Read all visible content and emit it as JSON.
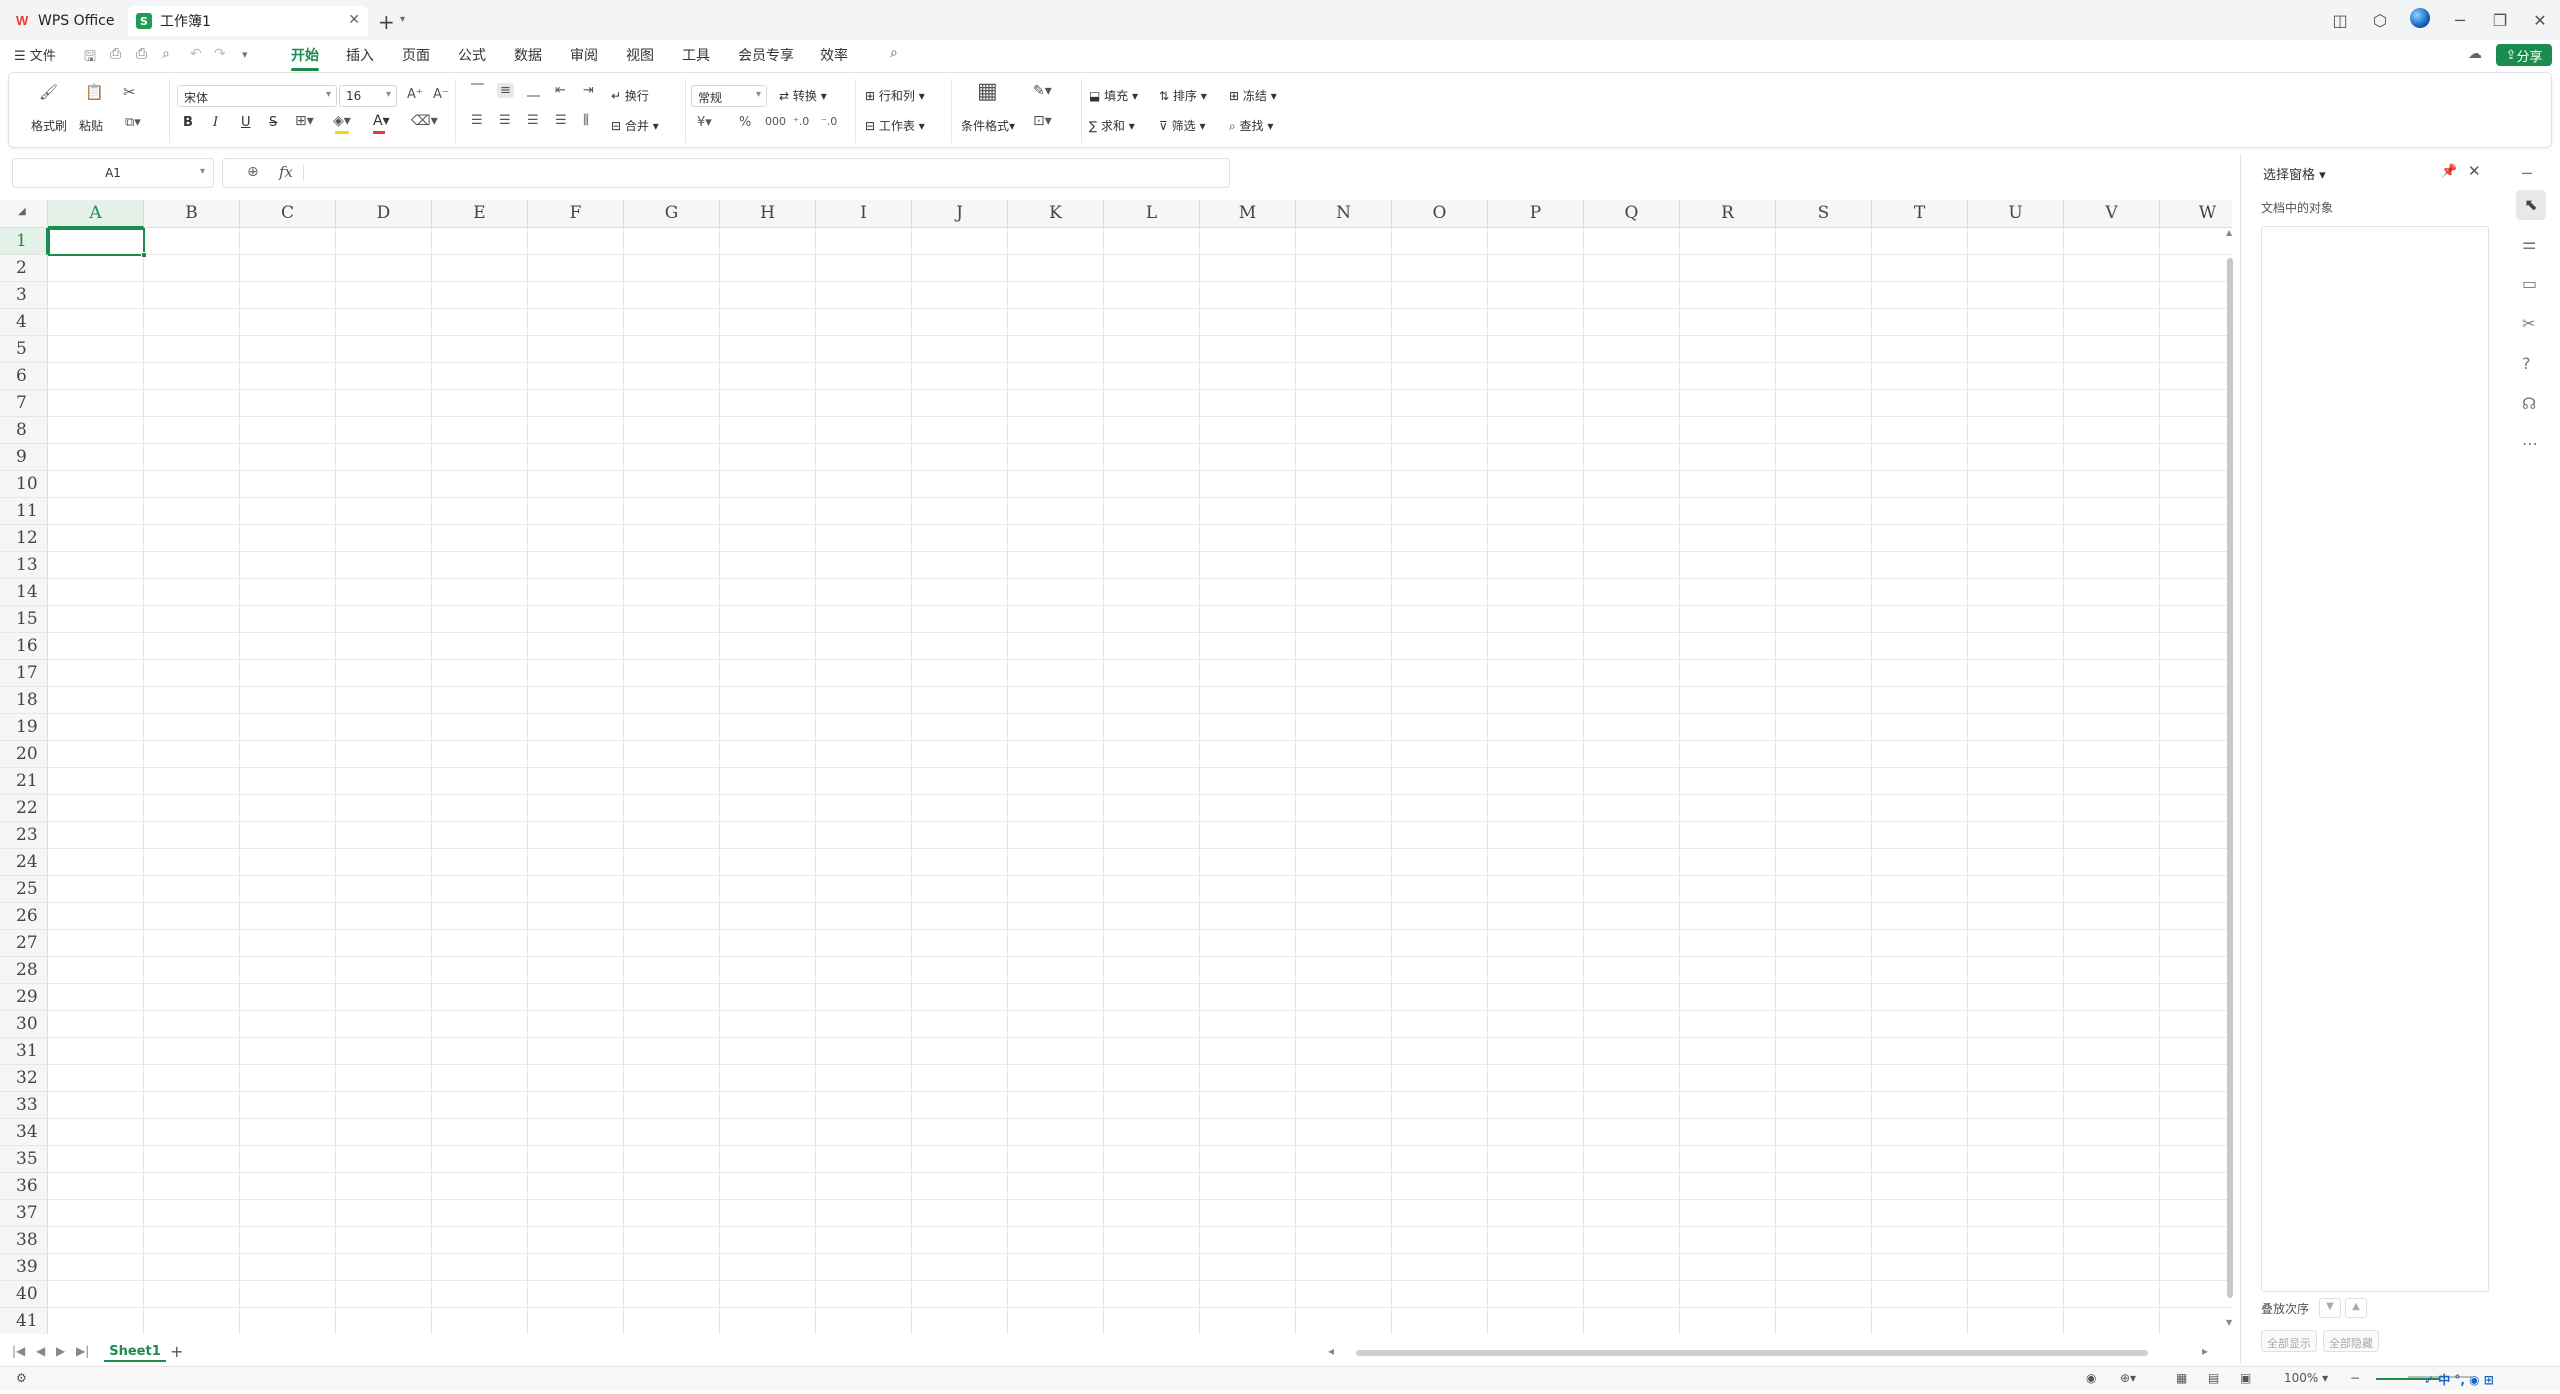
{
  "tabs": [
    {
      "label": "WPS Office"
    },
    {
      "label": "工作簿1"
    }
  ],
  "menu": {
    "file": "文件",
    "tabs": [
      "开始",
      "插入",
      "页面",
      "公式",
      "数据",
      "审阅",
      "视图",
      "工具",
      "会员专享",
      "效率"
    ],
    "active_tab": "开始",
    "share": "分享"
  },
  "ribbon": {
    "format_painter": "格式刷",
    "paste": "粘贴",
    "font_name": "宋体",
    "font_size": "16",
    "bold": "B",
    "italic": "I",
    "underline": "U",
    "strike": "S",
    "wrap": "换行",
    "merge": "合并",
    "number_format": "常规",
    "convert": "转换",
    "row_col": "行和列",
    "worksheet": "工作表",
    "cond_format": "条件格式",
    "fill": "填充",
    "sort": "排序",
    "freeze": "冻结",
    "sum": "求和",
    "filter": "筛选",
    "find": "查找",
    "font_color": "#e53935",
    "highlight_color": "#f5d800"
  },
  "formula_bar": {
    "cell_ref": "A1",
    "fx": "fx",
    "value": ""
  },
  "sheet": {
    "columns": [
      "A",
      "B",
      "C",
      "D",
      "E",
      "F",
      "G",
      "H",
      "I",
      "J",
      "K",
      "L",
      "M",
      "N",
      "O",
      "P",
      "Q",
      "R",
      "S",
      "T",
      "U",
      "V",
      "W"
    ],
    "rows": [
      "1",
      "2",
      "3",
      "4",
      "5",
      "6",
      "7",
      "8",
      "9",
      "10",
      "11",
      "12",
      "13",
      "14",
      "15",
      "16",
      "17",
      "18",
      "19",
      "20",
      "21",
      "22",
      "23",
      "24",
      "25",
      "26",
      "27",
      "28",
      "29",
      "30",
      "31",
      "32",
      "33",
      "34",
      "35",
      "36",
      "37",
      "38",
      "39",
      "40",
      "41"
    ],
    "active_column": "A",
    "active_row": "1",
    "tabs": [
      "Sheet1"
    ]
  },
  "status": {
    "zoom": "100%"
  },
  "selection_pane": {
    "title": "选择窗格",
    "subtitle": "文档中的对象",
    "stack_order": "叠放次序",
    "show_all": "全部显示",
    "hide_all": "全部隐藏"
  },
  "colors": {
    "accent": "#1a8c4e"
  }
}
